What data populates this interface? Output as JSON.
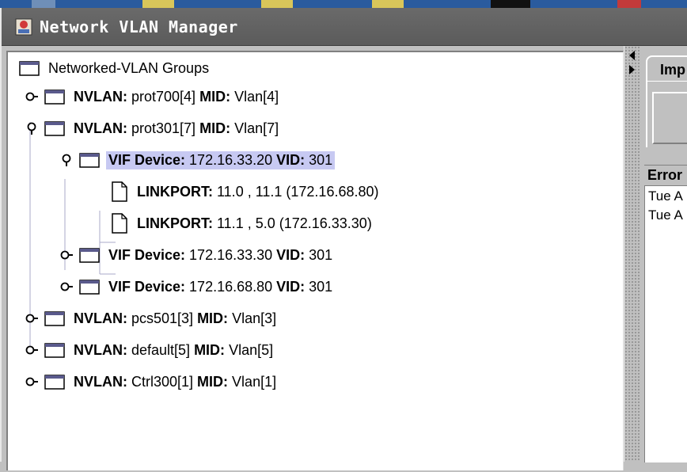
{
  "window": {
    "title": "Network VLAN Manager"
  },
  "colors": {
    "titlebar": "#5f5f5f",
    "selection": "#c7c9f2",
    "panel": "#c0c0c0",
    "tree_bg": "#ffffff"
  },
  "tree": {
    "root": {
      "label": "Networked-VLAN Groups",
      "icon": "folder-icon"
    },
    "nodes": [
      {
        "kind": "NVLAN",
        "key1": "NVLAN:",
        "val1": " prot700[4] ",
        "key2": "MID:",
        "val2": " Vlan[4]",
        "expanded": false,
        "icon": "folder-icon"
      },
      {
        "kind": "NVLAN",
        "key1": "NVLAN:",
        "val1": " prot301[7] ",
        "key2": "MID:",
        "val2": " Vlan[7]",
        "expanded": true,
        "icon": "folder-icon"
      },
      {
        "kind": "VIF",
        "key1": "VIF Device:",
        "val1": " 172.16.33.20 ",
        "key2": "VID:",
        "val2": " 301",
        "expanded": true,
        "selected": true,
        "icon": "folder-icon"
      },
      {
        "kind": "LINKPORT",
        "key1": "LINKPORT:",
        "val1": " 11.0 , 11.1 (172.16.68.80)",
        "icon": "document-icon"
      },
      {
        "kind": "LINKPORT",
        "key1": "LINKPORT:",
        "val1": " 11.1 , 5.0 (172.16.33.30)",
        "icon": "document-icon"
      },
      {
        "kind": "VIF",
        "key1": "VIF Device:",
        "val1": " 172.16.33.30 ",
        "key2": "VID:",
        "val2": " 301",
        "expanded": false,
        "icon": "folder-icon"
      },
      {
        "kind": "VIF",
        "key1": "VIF Device:",
        "val1": " 172.16.68.80 ",
        "key2": "VID:",
        "val2": " 301",
        "expanded": false,
        "icon": "folder-icon"
      },
      {
        "kind": "NVLAN",
        "key1": "NVLAN:",
        "val1": " pcs501[3] ",
        "key2": "MID:",
        "val2": " Vlan[3]",
        "expanded": false,
        "icon": "folder-icon"
      },
      {
        "kind": "NVLAN",
        "key1": "NVLAN:",
        "val1": " default[5] ",
        "key2": "MID:",
        "val2": " Vlan[5]",
        "expanded": false,
        "icon": "folder-icon"
      },
      {
        "kind": "NVLAN",
        "key1": "NVLAN:",
        "val1": " Ctrl300[1] ",
        "key2": "MID:",
        "val2": " Vlan[1]",
        "expanded": false,
        "icon": "folder-icon"
      }
    ]
  },
  "right_panel": {
    "tab_label": "Imp",
    "error_header": "Error",
    "error_rows": [
      "Tue A",
      "Tue A"
    ]
  }
}
